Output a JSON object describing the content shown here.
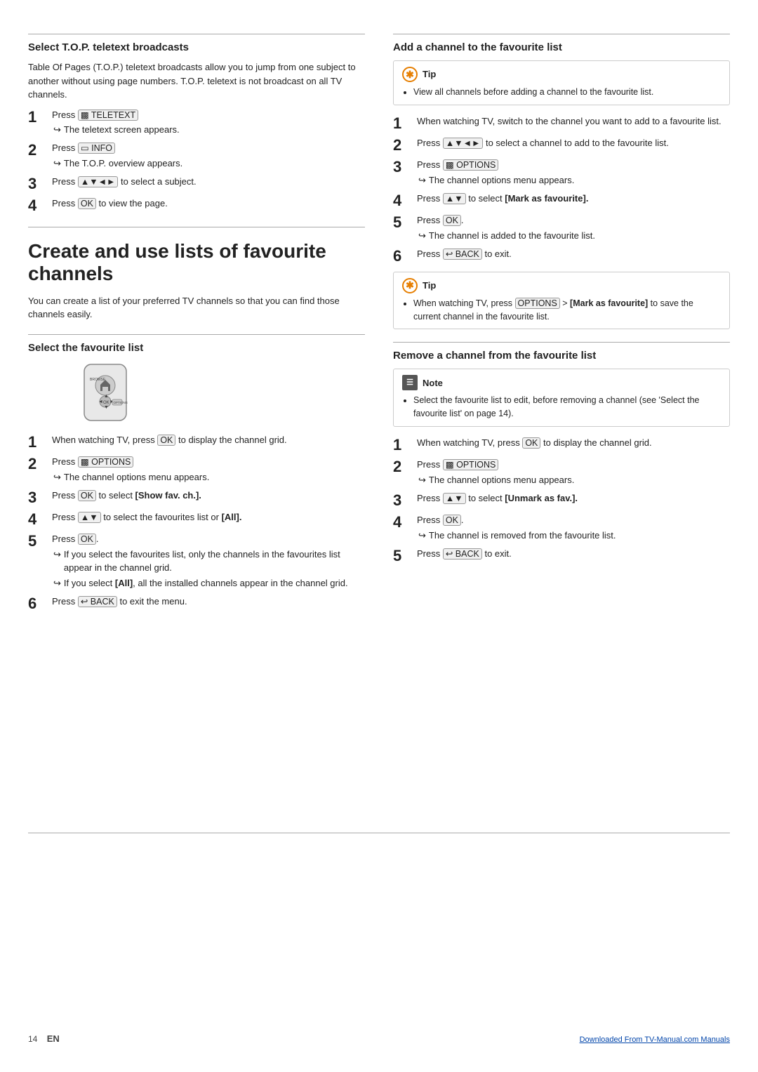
{
  "left": {
    "top_section": {
      "title": "Select T.O.P. teletext broadcasts",
      "body": "Table Of Pages (T.O.P.) teletext broadcasts allow you to jump from one subject to another without using page numbers. T.O.P. teletext is not broadcast on all TV channels.",
      "steps": [
        {
          "num": "1",
          "text": "Press",
          "button": "TELETEXT",
          "button_icon": "teletext",
          "sub": "The teletext screen appears."
        },
        {
          "num": "2",
          "text": "Press",
          "button": "INFO",
          "button_icon": "info",
          "sub": "The T.O.P. overview appears."
        },
        {
          "num": "3",
          "text": "Press",
          "button": "▲▼◄►",
          "suffix": "to select a subject.",
          "sub": null
        },
        {
          "num": "4",
          "text": "Press",
          "button": "OK",
          "suffix": "to view the page.",
          "sub": null
        }
      ]
    },
    "big_section": {
      "title": "Create and use lists of favourite channels",
      "body": "You can create a list of your preferred TV channels so that you can find those channels easily."
    },
    "fav_section": {
      "title": "Select the favourite list",
      "steps": [
        {
          "num": "1",
          "text": "When watching TV, press",
          "button": "OK",
          "suffix": "to display the channel grid.",
          "sub": null
        },
        {
          "num": "2",
          "text": "Press",
          "button": "OPTIONS",
          "button_icon": "options",
          "sub": "The channel options menu appears."
        },
        {
          "num": "3",
          "text": "Press",
          "button": "OK",
          "suffix": "to select",
          "bold_suffix": "[Show fav. ch.].",
          "sub": null
        },
        {
          "num": "4",
          "text": "Press",
          "button": "▲▼",
          "suffix": "to select the favourites list or",
          "bold_suffix": "[All].",
          "sub": null
        },
        {
          "num": "5",
          "text": "Press",
          "button": "OK",
          "suffix": ".",
          "sub1": "If you select the favourites list, only the channels in the favourites list appear in the channel grid.",
          "sub2": "If you select [All], all the installed channels appear in the channel grid."
        },
        {
          "num": "6",
          "text": "Press",
          "button": "BACK",
          "button_icon": "back",
          "suffix": "to exit the menu.",
          "sub": null
        }
      ]
    }
  },
  "right": {
    "add_section": {
      "title": "Add a channel to the favourite list",
      "tip1": {
        "label": "Tip",
        "items": [
          "View all channels before adding a channel to the favourite list."
        ]
      },
      "steps": [
        {
          "num": "1",
          "text": "When watching TV, switch to the channel you want to add to a favourite list.",
          "sub": null
        },
        {
          "num": "2",
          "text": "Press",
          "button": "▲▼◄►",
          "suffix": "to select a channel to add to the favourite list.",
          "sub": null
        },
        {
          "num": "3",
          "text": "Press",
          "button": "OPTIONS",
          "button_icon": "options",
          "sub": "The channel options menu appears."
        },
        {
          "num": "4",
          "text": "Press",
          "button": "▲▼",
          "suffix": "to select",
          "bold_suffix": "[Mark as favourite].",
          "sub": null
        },
        {
          "num": "5",
          "text": "Press",
          "button": "OK",
          "suffix": ".",
          "sub": "The channel is added to the favourite list."
        },
        {
          "num": "6",
          "text": "Press",
          "button": "BACK",
          "button_icon": "back",
          "suffix": "to exit.",
          "sub": null
        }
      ],
      "tip2": {
        "label": "Tip",
        "items": [
          "When watching TV, press OPTIONS > [Mark as favourite] to save the current channel in the favourite list."
        ]
      }
    },
    "remove_section": {
      "title": "Remove a channel from the favourite list",
      "note": {
        "label": "Note",
        "items": [
          "Select the favourite list to edit, before removing a channel (see 'Select the favourite list' on page 14)."
        ]
      },
      "steps": [
        {
          "num": "1",
          "text": "When watching TV, press",
          "button": "OK",
          "suffix": "to display the channel grid.",
          "sub": null
        },
        {
          "num": "2",
          "text": "Press",
          "button": "OPTIONS",
          "button_icon": "options",
          "sub": "The channel options menu appears."
        },
        {
          "num": "3",
          "text": "Press",
          "button": "▲▼",
          "suffix": "to select",
          "bold_suffix": "[Unmark as fav.].",
          "sub": null
        },
        {
          "num": "4",
          "text": "Press",
          "button": "OK",
          "suffix": ".",
          "sub": "The channel is removed from the favourite list."
        },
        {
          "num": "5",
          "text": "Press",
          "button": "BACK",
          "button_icon": "back",
          "suffix": "to exit.",
          "sub": null
        }
      ]
    }
  },
  "footer": {
    "page_num": "14",
    "lang": "EN",
    "link_text": "Downloaded From TV-Manual.com Manuals",
    "link_url": "#"
  }
}
